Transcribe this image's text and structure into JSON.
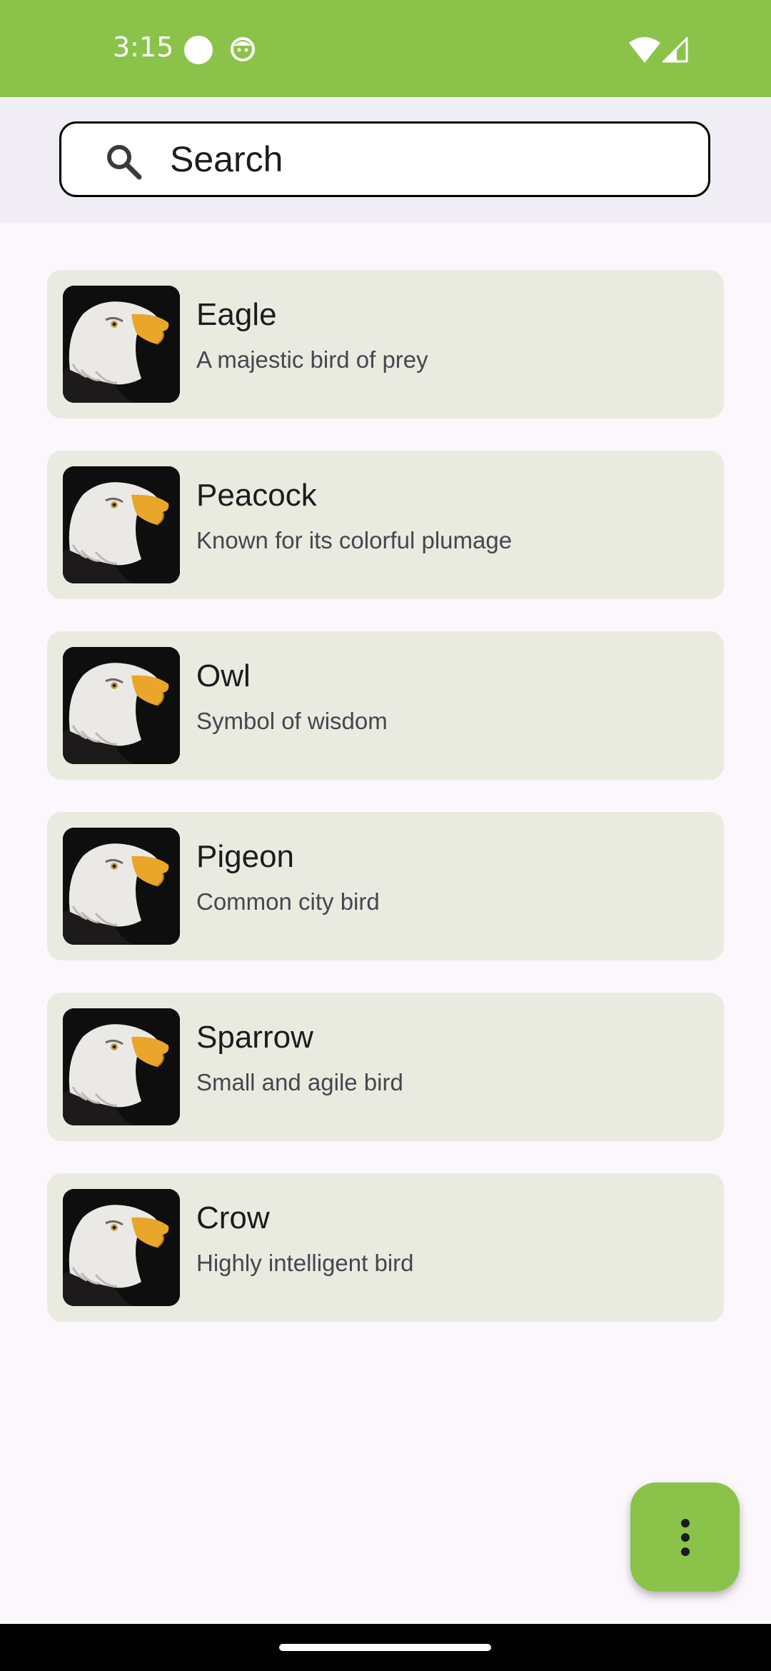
{
  "status_bar": {
    "time": "3:15",
    "background": "#8bc34a",
    "icons": [
      "circle-notification-icon",
      "face-notification-icon",
      "wifi-icon",
      "signal-icon"
    ]
  },
  "search": {
    "placeholder": "Search",
    "value": "",
    "icon": "search-icon"
  },
  "birds": [
    {
      "name": "Eagle",
      "description": "A majestic bird of prey",
      "image": "eagle-photo"
    },
    {
      "name": "Peacock",
      "description": "Known for its colorful plumage",
      "image": "eagle-photo"
    },
    {
      "name": "Owl",
      "description": "Symbol of wisdom",
      "image": "eagle-photo"
    },
    {
      "name": "Pigeon",
      "description": "Common city bird",
      "image": "eagle-photo"
    },
    {
      "name": "Sparrow",
      "description": "Small and agile bird",
      "image": "eagle-photo"
    },
    {
      "name": "Crow",
      "description": "Highly intelligent bird",
      "image": "eagle-photo"
    }
  ],
  "fab": {
    "icon": "more-vertical-icon",
    "background": "#8bc34a"
  },
  "colors": {
    "accent": "#8bc34a",
    "card": "#eaebe0",
    "page": "#fcf7fc",
    "search_band": "#f1edf4"
  }
}
